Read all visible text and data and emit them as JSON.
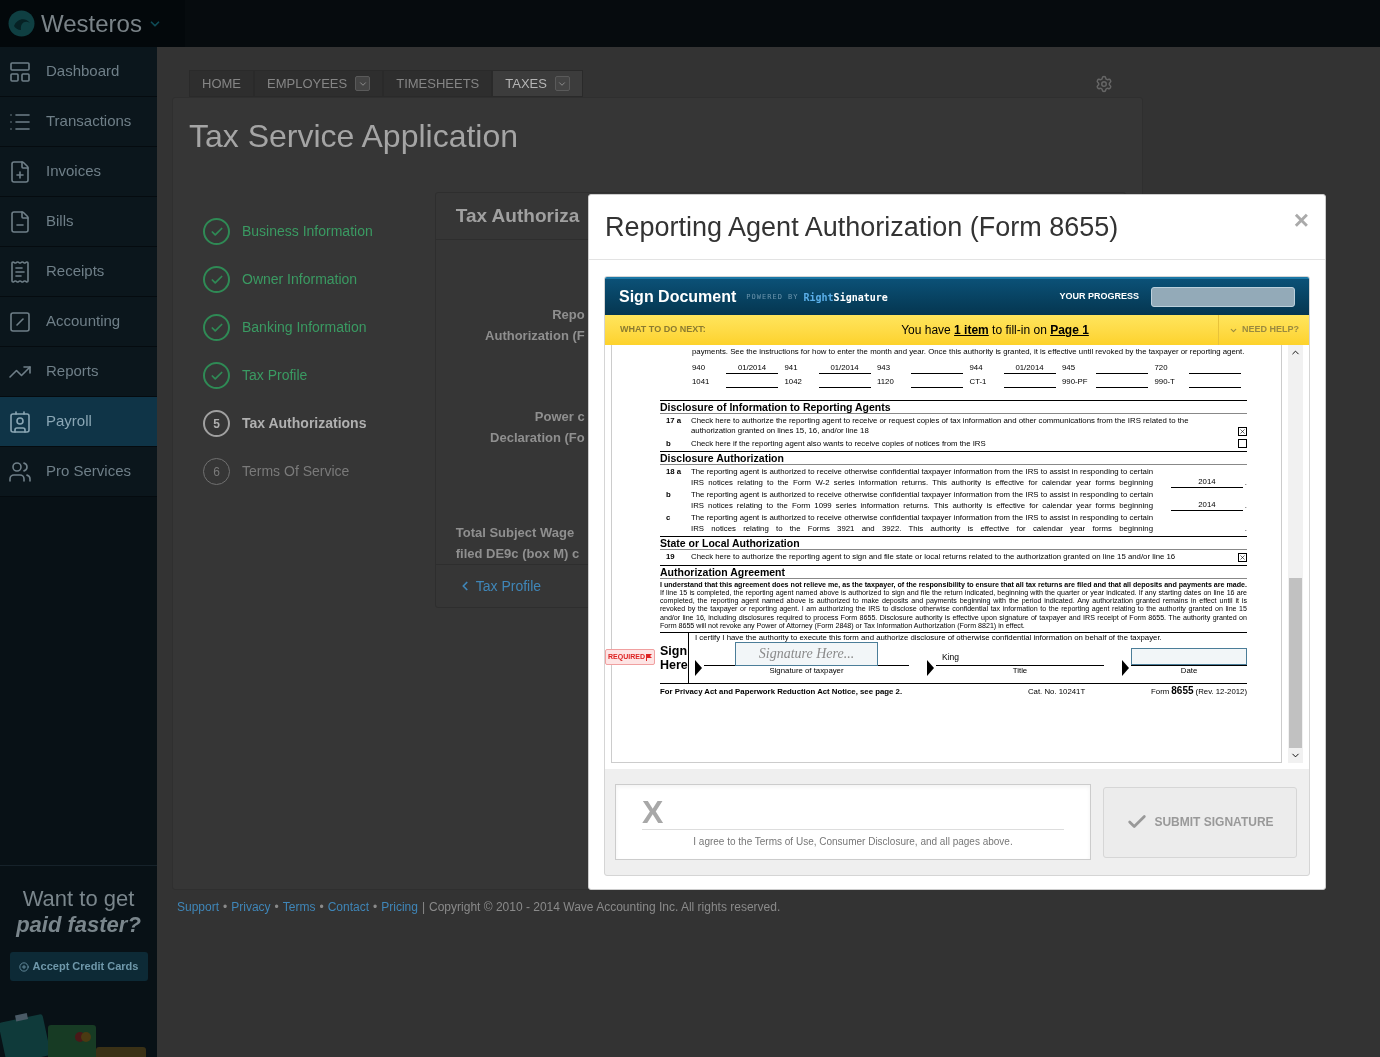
{
  "app": {
    "name": "Westeros"
  },
  "sidebar": {
    "items": [
      {
        "label": "Dashboard",
        "selected": false
      },
      {
        "label": "Transactions",
        "selected": false
      },
      {
        "label": "Invoices",
        "selected": false
      },
      {
        "label": "Bills",
        "selected": false
      },
      {
        "label": "Receipts",
        "selected": false
      },
      {
        "label": "Accounting",
        "selected": false
      },
      {
        "label": "Reports",
        "selected": false
      },
      {
        "label": "Payroll",
        "selected": true
      },
      {
        "label": "Pro Services",
        "selected": false
      }
    ]
  },
  "promo": {
    "line_1": "Want to get",
    "line_2": "paid faster?",
    "button": "Accept Credit Cards"
  },
  "tabs": [
    {
      "label": "HOME",
      "dropdown": false,
      "selected": false
    },
    {
      "label": "EMPLOYEES",
      "dropdown": true,
      "selected": false
    },
    {
      "label": "TIMESHEETS",
      "dropdown": false,
      "selected": false
    },
    {
      "label": "TAXES",
      "dropdown": true,
      "selected": true
    }
  ],
  "page_title": "Tax Service Application",
  "steps": [
    {
      "label": "Business Information",
      "completed": true,
      "selected": false
    },
    {
      "label": "Owner Information",
      "completed": true,
      "selected": false
    },
    {
      "label": "Banking Information",
      "completed": true,
      "selected": false
    },
    {
      "label": "Tax Profile",
      "completed": true,
      "selected": false
    },
    {
      "label": "Tax Authorizations",
      "completed": false,
      "selected": true,
      "number": "5"
    },
    {
      "label": "Terms Of Service",
      "completed": false,
      "selected": false,
      "number": "6"
    }
  ],
  "card": {
    "title": "Tax Authoriza",
    "groups": [
      {
        "lines": [
          "Repo",
          "Authorization (F"
        ]
      },
      {
        "lines": [
          "Power c",
          "Declaration (Fo"
        ]
      },
      {
        "lines": [
          "Total Subject Wage",
          "filed DE9c (box M) c"
        ]
      }
    ],
    "back_link": "Tax Profile"
  },
  "footer": {
    "items": [
      {
        "kind": "link",
        "text": "Support"
      },
      {
        "kind": "bullet",
        "text": "•"
      },
      {
        "kind": "link",
        "text": "Privacy"
      },
      {
        "kind": "bullet",
        "text": "•"
      },
      {
        "kind": "link",
        "text": "Terms"
      },
      {
        "kind": "bullet",
        "text": "•"
      },
      {
        "kind": "link",
        "text": "Contact"
      },
      {
        "kind": "bullet",
        "text": "•"
      },
      {
        "kind": "link",
        "text": "Pricing"
      },
      {
        "kind": "divider",
        "text": "|"
      },
      {
        "kind": "text",
        "text": "Copyright © 2010 - 2014 Wave Accounting Inc. All rights reserved."
      }
    ]
  },
  "modal": {
    "title": "Reporting Agent Authorization (Form 8655)",
    "close": "×",
    "signer": {
      "title": "Sign Document",
      "powered_by": "POWERED BY",
      "brand_1": "Right",
      "brand_2": "Signature",
      "progress_label": "YOUR PROGRESS",
      "level": 0,
      "next_label": "WHAT TO DO NEXT:",
      "next_message": "You have **1 item** to fill-in on **Page 1**",
      "help": "NEED HELP?",
      "form": {
        "line16_text": "payments. See the instructions for how to enter the month and year. Once this authority is granted, it is effective until revoked by the taxpayer or reporting agent.",
        "line16_entries": [
          {
            "form": "940",
            "date": "01/2014"
          },
          {
            "form": "941",
            "date": "01/2014"
          },
          {
            "form": "943"
          },
          {
            "form": "944",
            "date": "01/2014"
          },
          {
            "form": "945"
          },
          {
            "form": "720"
          },
          {
            "form": "1041"
          },
          {
            "form": "1042"
          },
          {
            "form": "1120"
          },
          {
            "form": "CT-1"
          },
          {
            "form": "990-PF"
          },
          {
            "form": "990-T"
          }
        ],
        "sections": [
          {
            "heading": "Disclosure of Information to Reporting Agents",
            "items": [
              {
                "kind": "checkbox",
                "number": "17 a",
                "text": "Check here to authorize the reporting agent to receive or request copies of tax information and other communications from the IRS related to the authorization granted on lines 15, 16, and/or line 18",
                "checked": true
              },
              {
                "kind": "checkbox",
                "number": "b",
                "text": "Check here if the reporting agent also wants to receive copies of notices from the IRS",
                "checked": false
              }
            ]
          },
          {
            "heading": "Disclosure Authorization",
            "items": [
              {
                "kind": "year",
                "number": "18 a",
                "text": "The reporting agent is authorized to receive otherwise confidential taxpayer information from the IRS to assist in responding to certain IRS notices relating to the Form W-2 series information returns. This authority is effective for calendar year forms beginning",
                "value": "2014",
                "end": "."
              },
              {
                "kind": "year",
                "number": "b",
                "text": "The reporting agent is authorized to receive otherwise confidential taxpayer information from the IRS to assist in responding to certain IRS notices relating to the Form 1099 series information returns. This authority is effective for calendar year forms beginning",
                "value": "2014",
                "end": "."
              },
              {
                "kind": "year",
                "number": "c",
                "text": "The reporting agent is authorized to receive otherwise confidential taxpayer information from the IRS to assist in responding to certain IRS notices relating to the Forms 3921 and 3922. This authority is effective for calendar year forms beginning",
                "end": "."
              }
            ]
          },
          {
            "heading": "State or Local Authorization",
            "items": [
              {
                "kind": "checkbox",
                "number": "19",
                "text": "Check here to authorize the reporting agent to sign and file state or local returns related to the authorization granted on line 15 and/or line 16",
                "checked": true
              }
            ]
          },
          {
            "heading": "Authorization Agreement",
            "items": [
              {
                "kind": "paragraph",
                "text": "**I understand that this agreement does not relieve me, as the taxpayer, of the responsibility to ensure that all tax returns are filed and that all deposits and payments are made.** If line 15 is completed, the reporting agent named above is authorized to sign and file the return indicated, beginning with the quarter or year indicated. If any starting dates on line 16 are completed, the reporting agent named above is authorized to make deposits and payments beginning with the period indicated. Any authorization granted remains in effect until it is revoked by the taxpayer or reporting agent. I am authorizing the IRS to disclose otherwise confidential tax information to the reporting agent relating to the authority granted on line 15 and/or line 16, including disclosures required to process Form 8655. Disclosure authority is effective upon signature of taxpayer and IRS receipt of Form 8655. The authority granted on Form 8655 will not revoke any Power of Attorney (Form 2848) or Tax Information Authorization (Form 8821) in effect."
              }
            ]
          }
        ],
        "sign": {
          "label_1": "Sign",
          "label_2": "Here",
          "required": "REQUIRED",
          "certify": "I certify I have the authority to execute this form and authorize disclosure of otherwise confidential information on behalf of the taxpayer.",
          "signature_placeholder": "Signature Here...",
          "signature_caption": "Signature of taxpayer",
          "title_value": "King",
          "title_caption": "Title",
          "date_caption": "Date"
        },
        "footer_notice": "For Privacy Act and Paperwork Reduction Act Notice, see page 2.",
        "cat_no": "Cat. No. 10241T",
        "form_word": "Form",
        "form_number": "8655",
        "revision": "(Rev. 12-2012)"
      },
      "pad_mark": "X",
      "pad_text": "I agree to the Terms of Use, Consumer Disclosure, and all pages above.",
      "submit": {
        "label": "SUBMIT SIGNATURE",
        "disabled": true
      }
    }
  }
}
